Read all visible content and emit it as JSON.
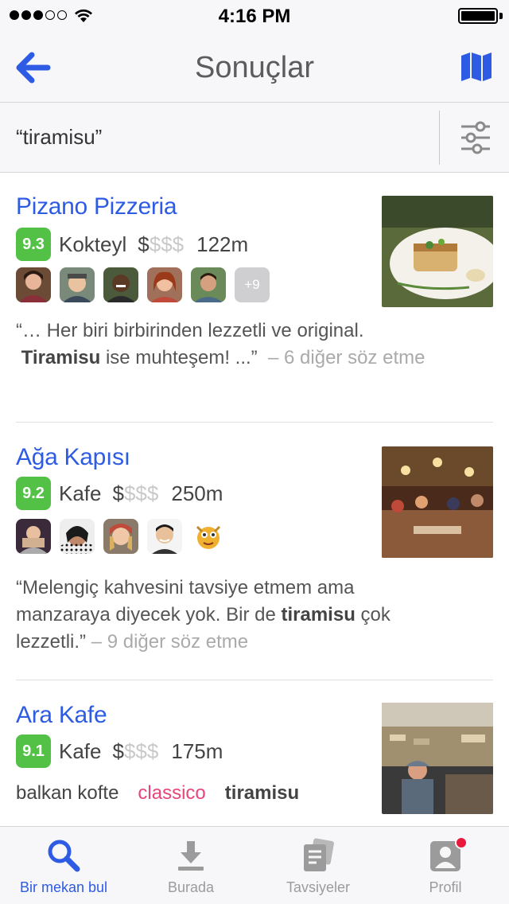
{
  "status": {
    "time": "4:16 PM",
    "signal_bars": 3,
    "signal_total": 5
  },
  "nav": {
    "title": "Sonuçlar",
    "back_icon": "back-arrow-icon",
    "map_icon": "map-icon"
  },
  "search": {
    "query": "“tiramisu”",
    "filter_icon": "filter-sliders-icon"
  },
  "results": [
    {
      "name": "Pizano Pizzeria",
      "score": "9.3",
      "category": "Kokteyl",
      "price_active": "$",
      "price_inactive": "$$$",
      "distance": "122m",
      "more_friends": "+9",
      "quote_line1": "“… Her biri birbirinden lezzetli ve original.",
      "quote_bold": "Tiramisu",
      "quote_line2_rest": " ise muhteşem! ...”",
      "mentions": "– 6 diğer söz etme"
    },
    {
      "name": "Ağa Kapısı",
      "score": "9.2",
      "category": "Kafe",
      "price_active": "$",
      "price_inactive": "$$$",
      "distance": "250m",
      "quote_line1": "“Melengiç kahvesini tavsiye etmem ama",
      "quote_line2_pre": " manzaraya diyecek yok. Bir de ",
      "quote_bold": "tiramisu",
      "quote_line2_post": " çok",
      "quote_line3": " lezzetli.”",
      "mentions": "– 9 diğer söz etme"
    },
    {
      "name": "Ara Kafe",
      "score": "9.1",
      "category": "Kafe",
      "price_active": "$",
      "price_inactive": "$$$",
      "distance": "175m",
      "tags": [
        "balkan kofte",
        "classico",
        "tiramisu"
      ]
    }
  ],
  "tabs": [
    {
      "label": "Bir mekan bul",
      "icon": "search-icon",
      "active": true
    },
    {
      "label": "Burada",
      "icon": "check-in-icon",
      "active": false
    },
    {
      "label": "Tavsiyeler",
      "icon": "tips-icon",
      "active": false
    },
    {
      "label": "Profil",
      "icon": "profile-icon",
      "active": false,
      "badge": true
    }
  ],
  "colors": {
    "accent": "#2d5be3",
    "score_green": "#52c145",
    "tag_pink": "#e9457a",
    "notification": "#e8193c"
  }
}
